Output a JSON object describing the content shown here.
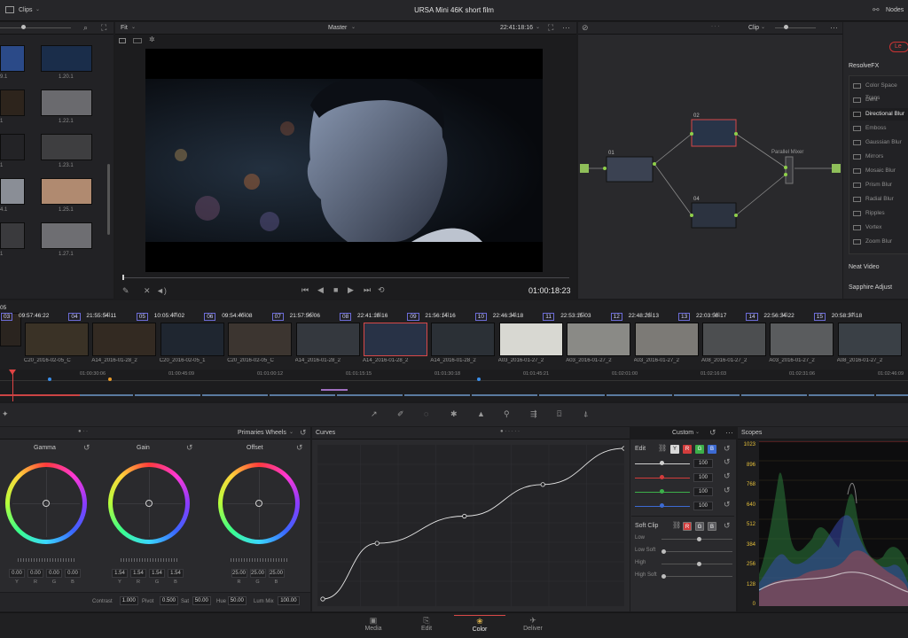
{
  "app": {
    "project_title": "URSA Mini 46K short film",
    "left_menu": "Clips",
    "right_menu": "Nodes"
  },
  "viewer": {
    "fit_label": "Fit",
    "timeline_name": "Master",
    "header_timecode": "22:41:18:16",
    "playhead_timecode": "01:00:18:23"
  },
  "gallery": {
    "items": [
      {
        "label": "9.1"
      },
      {
        "label": "1.20.1"
      },
      {
        "label": "1"
      },
      {
        "label": "1.22.1"
      },
      {
        "label": "1"
      },
      {
        "label": "1.23.1"
      },
      {
        "label": "4.1"
      },
      {
        "label": "1.25.1"
      },
      {
        "label": "1"
      },
      {
        "label": "1.27.1"
      }
    ]
  },
  "nodes": {
    "mode_label": "Clip",
    "node_labels": [
      "01",
      "02",
      "04"
    ],
    "mixer_label": "Parallel Mixer"
  },
  "fx_panel": {
    "badge": "Le",
    "section_title": "ResolveFX",
    "items": [
      {
        "label": "Color Space Trans",
        "selected": false
      },
      {
        "label": "Dent",
        "selected": false
      },
      {
        "label": "Directional Blur",
        "selected": true
      },
      {
        "label": "Emboss",
        "selected": false
      },
      {
        "label": "Gaussian Blur",
        "selected": false
      },
      {
        "label": "Mirrors",
        "selected": false
      },
      {
        "label": "Mosaic Blur",
        "selected": false
      },
      {
        "label": "Prism Blur",
        "selected": false
      },
      {
        "label": "Radial Blur",
        "selected": false
      },
      {
        "label": "Ripples",
        "selected": false
      },
      {
        "label": "Vortex",
        "selected": false
      },
      {
        "label": "Zoom Blur",
        "selected": false
      }
    ],
    "section2": "Neat Video",
    "section3": "Sapphire Adjust"
  },
  "clips": [
    {
      "num": "03",
      "tc": "09:57:46:22",
      "track": "V1",
      "name": "C20_2016-02-05_C",
      "selected": false,
      "color": "#3a3226"
    },
    {
      "num": "04",
      "tc": "21:55:54:11",
      "track": "V1",
      "name": "A14_2016-01-28_2",
      "selected": false,
      "color": "#332a22"
    },
    {
      "num": "05",
      "tc": "10:05:47:02",
      "track": "V1",
      "name": "C20_2016-02-05_1",
      "selected": false,
      "color": "#1f2630"
    },
    {
      "num": "06",
      "tc": "09:54:40:08",
      "track": "V3",
      "name": "C20_2016-02-05_C",
      "selected": false,
      "color": "#3c3530"
    },
    {
      "num": "07",
      "tc": "21:57:56:06",
      "track": "V1",
      "name": "A14_2016-01-28_2",
      "selected": false,
      "color": "#34383e"
    },
    {
      "num": "08",
      "tc": "22:41:18:16",
      "track": "V1",
      "name": "A14_2016-01-28_2",
      "selected": true,
      "color": "#283246"
    },
    {
      "num": "09",
      "tc": "21:56:14:16",
      "track": "V1",
      "name": "A14_2016-01-28_2",
      "selected": false,
      "color": "#2b3036"
    },
    {
      "num": "10",
      "tc": "22:46:34:18",
      "track": "V1",
      "name": "A03_2016-01-27_2",
      "selected": false,
      "color": "#d8d8d2"
    },
    {
      "num": "11",
      "tc": "22:53:15:03",
      "track": "V1",
      "name": "A03_2016-01-27_2",
      "selected": false,
      "color": "#8a8a86"
    },
    {
      "num": "12",
      "tc": "22:48:23:13",
      "track": "V1",
      "name": "A03_2016-01-27_2",
      "selected": false,
      "color": "#7c7a76"
    },
    {
      "num": "13",
      "tc": "22:03:58:17",
      "track": "V1",
      "name": "A08_2016-01-27_2",
      "selected": false,
      "color": "#4c4e50"
    },
    {
      "num": "14",
      "tc": "22:56:34:22",
      "track": "V1",
      "name": "A03_2016-01-27_2",
      "selected": false,
      "color": "#5a5c5e"
    },
    {
      "num": "15",
      "tc": "20:58:37:18",
      "track": "V1",
      "name": "A08_2016-01-27_2",
      "selected": false,
      "color": "#3a4046"
    }
  ],
  "ruler": {
    "marks": [
      "01:00:30:06",
      "01:00:45:09",
      "01:01:00:12",
      "01:01:15:15",
      "01:01:30:18",
      "01:01:45:21",
      "01:02:01:00",
      "01:02:16:03",
      "01:02:31:06",
      "01:02:46:09"
    ]
  },
  "wheels_panel": {
    "mode": "Primaries Wheels",
    "wheels": [
      {
        "title": "Gamma",
        "values": [
          "0.00",
          "0.00",
          "0.00",
          "0.00"
        ],
        "channels": [
          "Y",
          "R",
          "G",
          "B"
        ]
      },
      {
        "title": "Gain",
        "values": [
          "1.54",
          "1.54",
          "1.54",
          "1.54"
        ],
        "channels": [
          "Y",
          "R",
          "G",
          "B"
        ]
      },
      {
        "title": "Offset",
        "values": [
          "25.00",
          "25.00",
          "25.00"
        ],
        "channels": [
          "R",
          "G",
          "B"
        ]
      }
    ],
    "footer": [
      {
        "label": "Contrast",
        "value": "1.000"
      },
      {
        "label": "Pivot",
        "value": "0.500"
      },
      {
        "label": "Sat",
        "value": "50.00"
      },
      {
        "label": "Hue",
        "value": "50.00"
      },
      {
        "label": "Lum Mix",
        "value": "100.00"
      }
    ]
  },
  "curves": {
    "title": "Curves",
    "mode": "Custom",
    "points": [
      [
        0,
        0
      ],
      [
        0.18,
        0.37
      ],
      [
        0.47,
        0.55
      ],
      [
        0.73,
        0.76
      ],
      [
        1,
        1
      ]
    ]
  },
  "edit_panel": {
    "title": "Edit",
    "channel_buttons": [
      "Y",
      "R",
      "G",
      "B"
    ],
    "values": [
      "100",
      "100",
      "100",
      "100"
    ],
    "soft_clip_title": "Soft Clip",
    "soft_buttons": [
      "R",
      "G",
      "B"
    ],
    "soft_rows": [
      "Low",
      "Low Soft",
      "High",
      "High Soft"
    ]
  },
  "scopes": {
    "title": "Scopes",
    "scale": [
      "1023",
      "896",
      "768",
      "640",
      "512",
      "384",
      "256",
      "128",
      "0"
    ]
  },
  "pages": [
    {
      "label": "Media",
      "active": false,
      "icon": "media-icon"
    },
    {
      "label": "Edit",
      "active": false,
      "icon": "edit-icon"
    },
    {
      "label": "Color",
      "active": true,
      "icon": "color-icon"
    },
    {
      "label": "Deliver",
      "active": false,
      "icon": "deliver-icon"
    }
  ]
}
